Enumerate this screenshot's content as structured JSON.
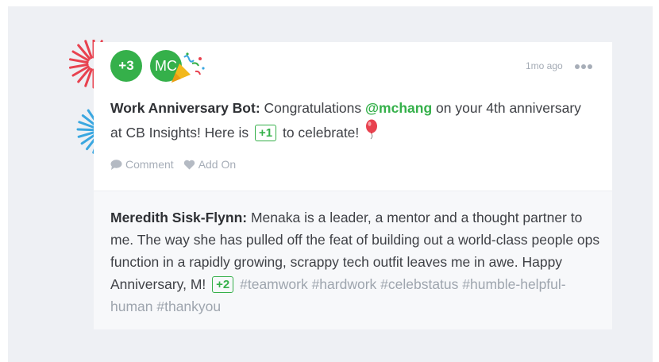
{
  "post": {
    "avatars": {
      "more_count": "+3",
      "user_initials": "MC"
    },
    "timestamp": "1mo ago",
    "author": "Work Anniversary Bot:",
    "message_part1": "Congratulations",
    "mention": "@mchang",
    "message_part2": "on your 4th anniversary at CB Insights! Here is",
    "points": "+1",
    "message_part3": "to celebrate!",
    "actions": {
      "comment_label": "Comment",
      "add_on_label": "Add On"
    }
  },
  "reply": {
    "author": "Meredith Sisk-Flynn:",
    "text": "Menaka is a leader, a mentor and a thought partner to me. The way she has pulled off the feat of building out a world-class people ops function in a rapidly growing, scrappy tech outfit leaves me in awe. Happy Anniversary, M!",
    "points": "+2",
    "hashtags": "#teamwork #hardwork #celebstatus #humble-helpful-human #thankyou"
  },
  "colors": {
    "accent_green": "#35b04a",
    "firework_red": "#e8424f",
    "firework_blue": "#3aa7e0",
    "muted_text": "#a7aeb8"
  }
}
